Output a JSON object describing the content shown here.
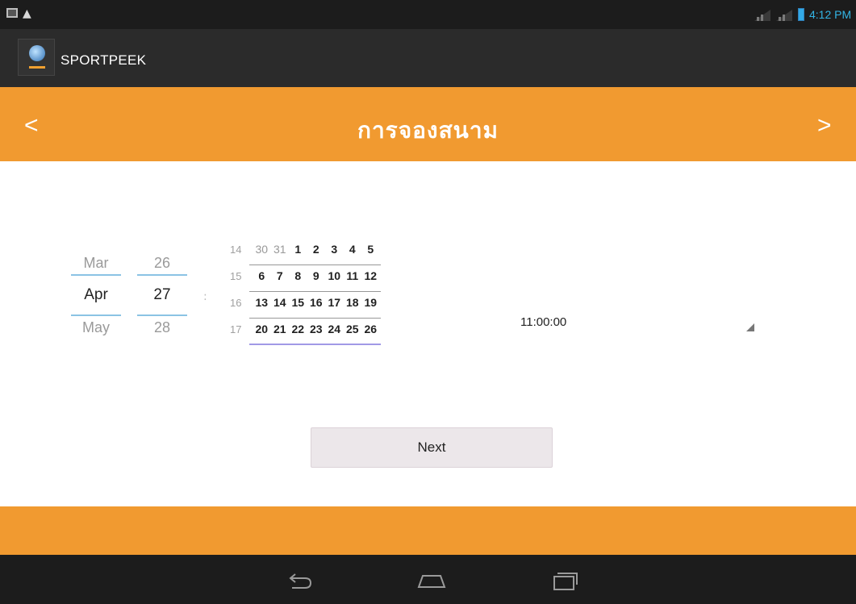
{
  "status_bar": {
    "time": "4:12 PM",
    "icons": [
      "picture-icon",
      "warning-icon",
      "signal-icon",
      "signal-icon",
      "battery-icon"
    ]
  },
  "action_bar": {
    "app_title": "SPORTPEEK",
    "app_icon": "app-logo-icon"
  },
  "header": {
    "title": "การจองสนาม",
    "prev_label": "<",
    "next_label": ">"
  },
  "date_picker": {
    "month": {
      "prev": "Mar",
      "current": "Apr",
      "next": "May"
    },
    "day": {
      "prev": "26",
      "current": "27",
      "next": "28"
    }
  },
  "calendar": {
    "weeks": [
      {
        "week": "14",
        "days": [
          "30",
          "31",
          "1",
          "2",
          "3",
          "4",
          "5"
        ],
        "muted": [
          true,
          true,
          false,
          false,
          false,
          false,
          false
        ]
      },
      {
        "week": "15",
        "days": [
          "6",
          "7",
          "8",
          "9",
          "10",
          "11",
          "12"
        ],
        "muted": [
          false,
          false,
          false,
          false,
          false,
          false,
          false
        ]
      },
      {
        "week": "16",
        "days": [
          "13",
          "14",
          "15",
          "16",
          "17",
          "18",
          "19"
        ],
        "muted": [
          false,
          false,
          false,
          false,
          false,
          false,
          false
        ]
      },
      {
        "week": "17",
        "days": [
          "20",
          "21",
          "22",
          "23",
          "24",
          "25",
          "26"
        ],
        "muted": [
          false,
          false,
          false,
          false,
          false,
          false,
          false
        ]
      }
    ]
  },
  "time_spinner": {
    "value": "11:00:00"
  },
  "buttons": {
    "next_label": "Next"
  },
  "nav_bar": {
    "icons": [
      "back-icon",
      "home-icon",
      "recents-icon"
    ]
  },
  "colors": {
    "accent_orange": "#f19a30",
    "status_blue": "#33b5e5",
    "bar_dark": "#1c1c1c"
  }
}
